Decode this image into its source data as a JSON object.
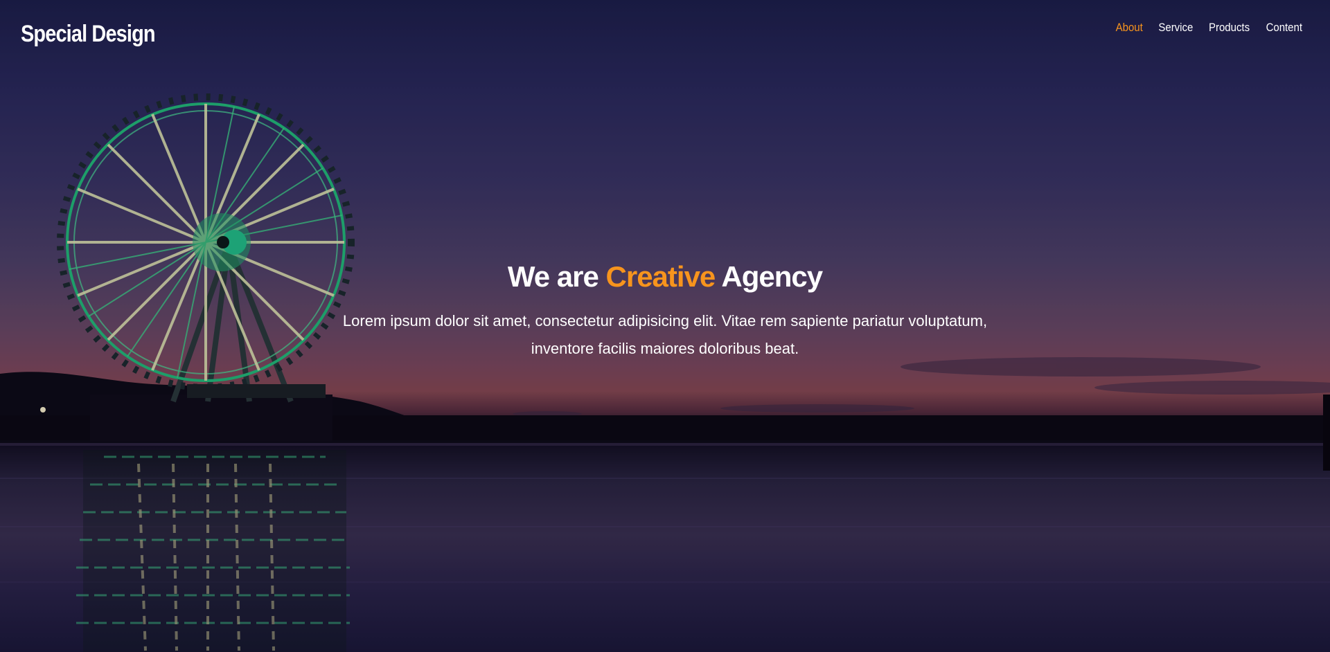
{
  "header": {
    "logo": "Special Design",
    "nav": [
      {
        "label": "About",
        "active": true
      },
      {
        "label": "Service",
        "active": false
      },
      {
        "label": "Products",
        "active": false
      },
      {
        "label": "Content",
        "active": false
      }
    ]
  },
  "hero": {
    "headline_prefix": "We are ",
    "headline_accent": "Creative",
    "headline_suffix": " Agency",
    "description": "Lorem ipsum dolor sit amet, consectetur adipisicing elit. Vitae rem sapiente pariatur voluptatum, inventore facilis maiores doloribus beat."
  },
  "colors": {
    "accent": "#f7941d",
    "text": "#ffffff"
  }
}
